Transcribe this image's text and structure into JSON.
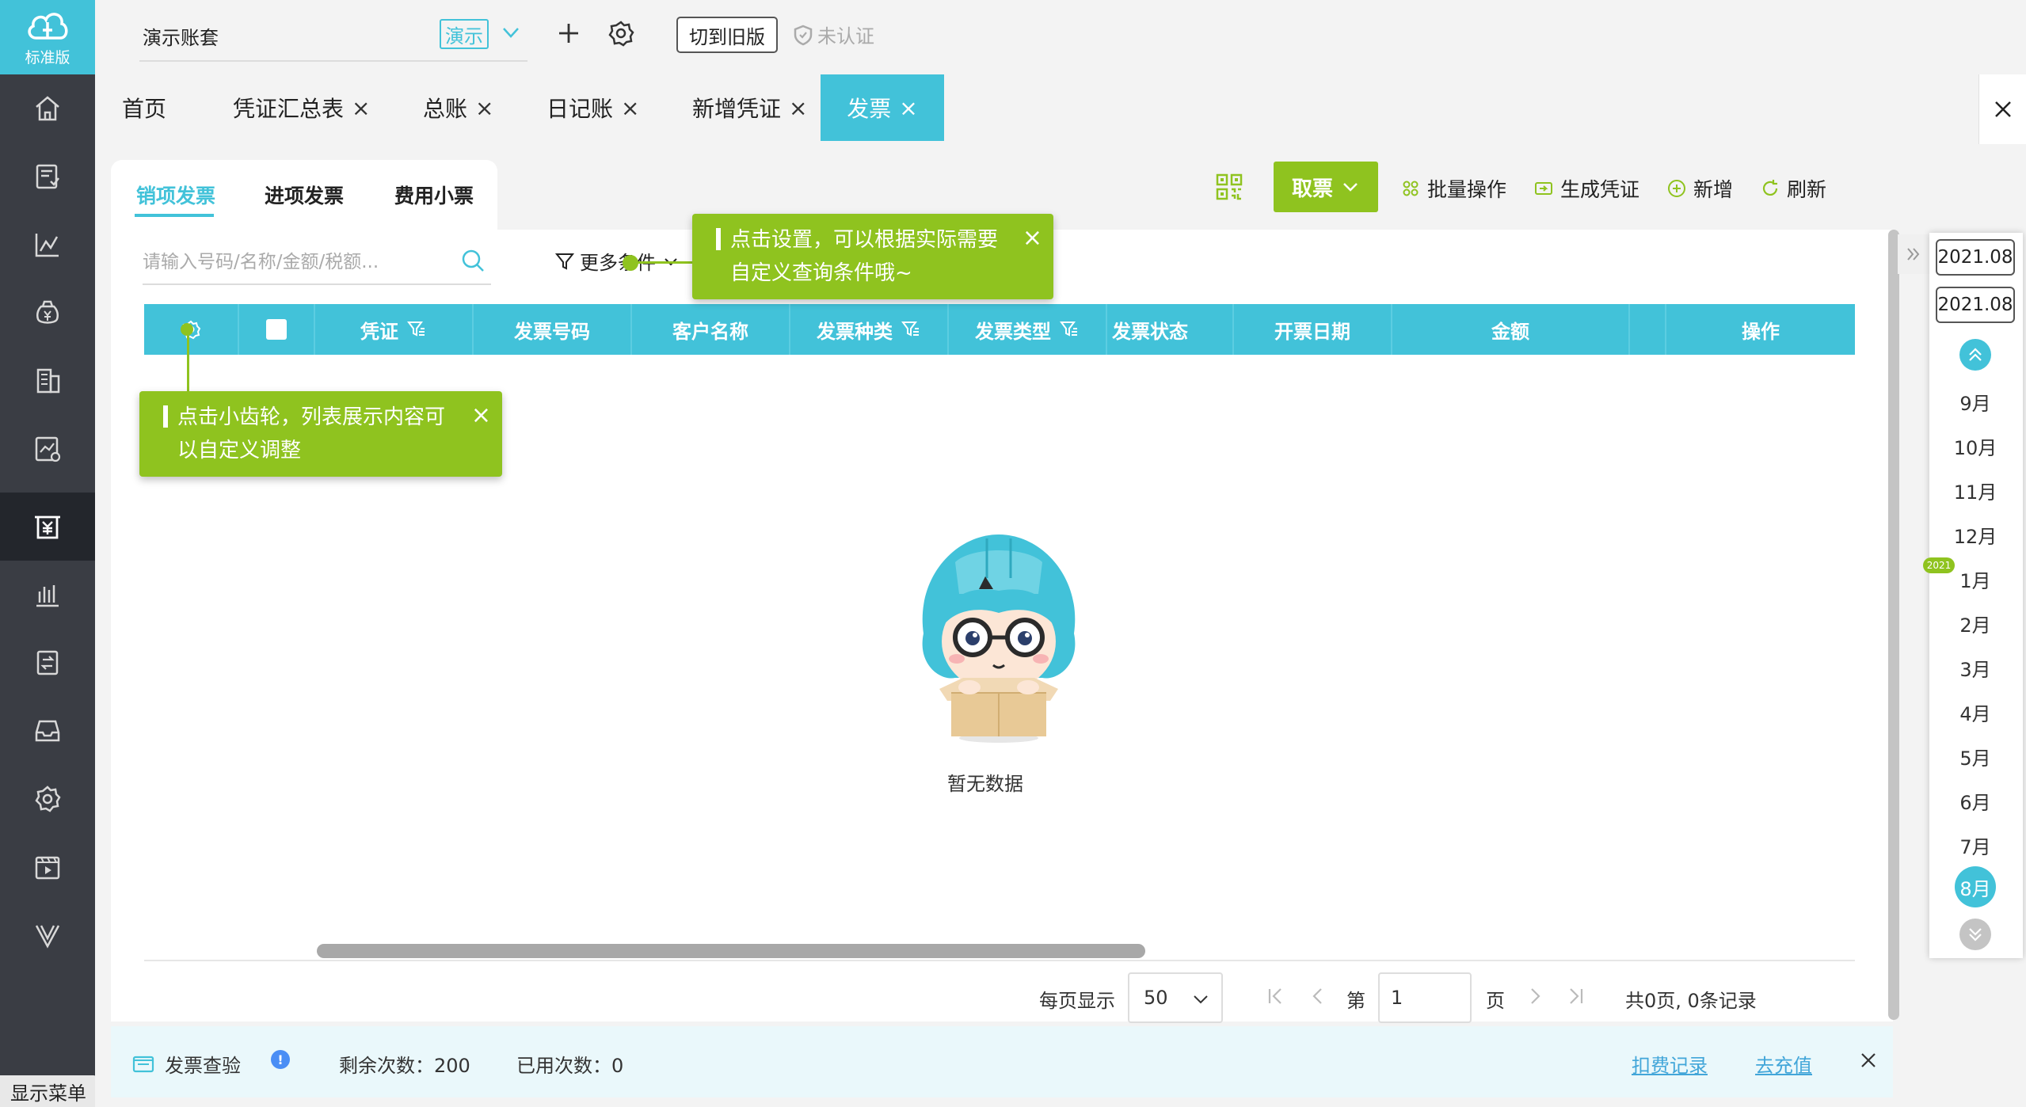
{
  "app": {
    "logo_label": "标准版",
    "brand_color": "#42c2d9",
    "accent_green": "#8fc31f"
  },
  "sidebar": {
    "items": [
      {
        "icon": "home-icon"
      },
      {
        "icon": "voucher-icon"
      },
      {
        "icon": "report-chart-icon"
      },
      {
        "icon": "finance-icon"
      },
      {
        "icon": "building-icon"
      },
      {
        "icon": "analysis-icon"
      },
      {
        "icon": "invoice-icon",
        "active": true
      },
      {
        "icon": "tax-icon"
      },
      {
        "icon": "transfer-icon"
      },
      {
        "icon": "archive-icon"
      },
      {
        "icon": "settings-icon"
      },
      {
        "icon": "video-icon"
      },
      {
        "icon": "vip-icon"
      }
    ],
    "show_menu_label": "显示菜单"
  },
  "topbar": {
    "book_name": "演示账套",
    "demo_tag": "演示",
    "switch_label": "切到旧版",
    "unverified_label": "未认证"
  },
  "tabs": [
    {
      "label": "首页",
      "closable": false
    },
    {
      "label": "凭证汇总表",
      "closable": true
    },
    {
      "label": "总账",
      "closable": true
    },
    {
      "label": "日记账",
      "closable": true
    },
    {
      "label": "新增凭证",
      "closable": true
    },
    {
      "label": "发票",
      "closable": true,
      "active": true
    }
  ],
  "tab_close_symbol": "×",
  "subtabs": [
    {
      "label": "销项发票",
      "active": true
    },
    {
      "label": "进项发票"
    },
    {
      "label": "费用小票"
    }
  ],
  "toolbar": {
    "fetch_label": "取票",
    "batch_label": "批量操作",
    "generate_label": "生成凭证",
    "add_label": "新增",
    "refresh_label": "刷新"
  },
  "search": {
    "placeholder": "请输入号码/名称/金额/税额...",
    "more_conditions": "更多条件"
  },
  "table": {
    "columns": [
      {
        "key": "gear",
        "label": ""
      },
      {
        "key": "check",
        "label": ""
      },
      {
        "key": "voucher",
        "label": "凭证",
        "filter": true
      },
      {
        "key": "number",
        "label": "发票号码"
      },
      {
        "key": "customer",
        "label": "客户名称"
      },
      {
        "key": "kind",
        "label": "发票种类",
        "filter": true
      },
      {
        "key": "type",
        "label": "发票类型",
        "filter": true
      },
      {
        "key": "status",
        "label": "发票状态"
      },
      {
        "key": "date",
        "label": "开票日期"
      },
      {
        "key": "amount",
        "label": "金额"
      },
      {
        "key": "blank",
        "label": ""
      },
      {
        "key": "ops",
        "label": "操作"
      }
    ],
    "rows": []
  },
  "tips": {
    "settings_line1": "点击设置，可以根据实际需要",
    "settings_line2": "自定义查询条件哦~",
    "gear_line1": "点击小齿轮，列表展示内容可",
    "gear_line2": "以自定义调整",
    "close_symbol": "×"
  },
  "empty_state": {
    "text": "暂无数据"
  },
  "pagination": {
    "per_page_label": "每页显示",
    "per_page_value": "50",
    "page_prefix": "第",
    "page_value": "1",
    "page_suffix": "页",
    "summary": "共0页, 0条记录"
  },
  "bottom_bar": {
    "check_label": "发票查验",
    "remaining_label": "剩余次数：200",
    "used_label": "已用次数：0",
    "deduct_link": "扣费记录",
    "recharge_link": "去充值"
  },
  "month_panel": {
    "start_date": "2021.08",
    "end_date": "2021.08",
    "year_badge": "2021",
    "months": [
      "9月",
      "10月",
      "11月",
      "12月",
      "1月",
      "2月",
      "3月",
      "4月",
      "5月",
      "6月",
      "7月",
      "8月"
    ],
    "active_month": "8月"
  }
}
